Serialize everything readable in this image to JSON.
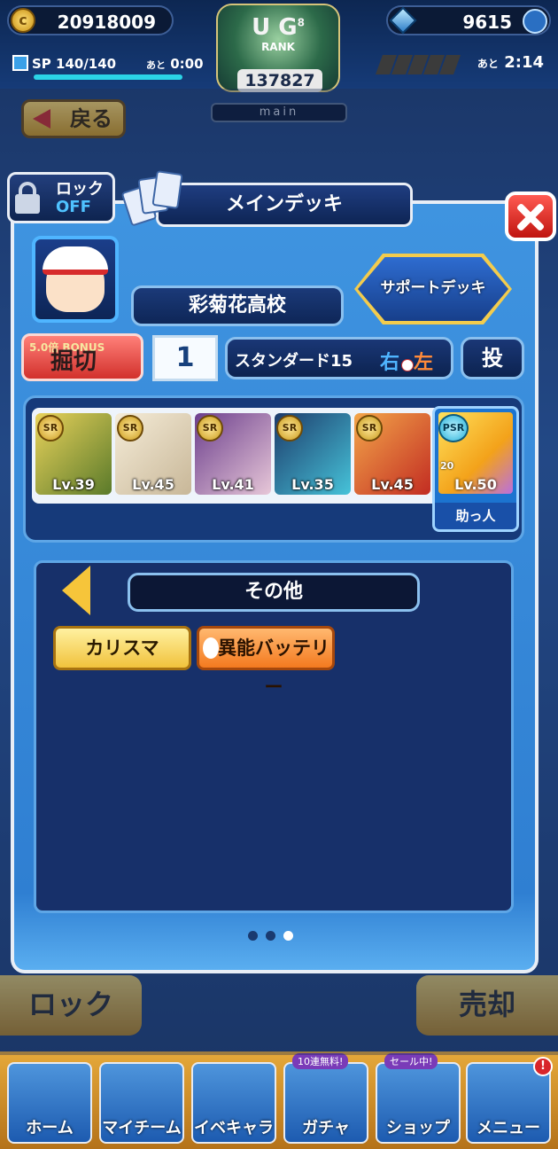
{
  "header": {
    "coins": "20918009",
    "coin_icon_glyph": "c",
    "gems": "9615",
    "sp_label": "SP 140/140",
    "sp_timer_prefix": "あと",
    "sp_timer": "0:00",
    "rank_ug": "U G",
    "rank_superscript": "8",
    "rank_label": "RANK",
    "rank_value": "137827",
    "mode_label": "main",
    "stamina_timer_prefix": "あと",
    "stamina_timer": "2:14",
    "back_label": "戻る"
  },
  "modal": {
    "lock_label": "ロック",
    "lock_state": "OFF",
    "title": "メインデッキ",
    "school": "彩菊花高校",
    "support_deck_label": "サポートデッキ",
    "bonus_small": "5.0倍 BONUS",
    "bonus_label": "掘切",
    "deck_number": "1",
    "deck_type": "スタンダード15",
    "hand_right": "右",
    "hand_left": "左",
    "position": "投",
    "cards": [
      {
        "rarity": "SR",
        "level": "Lv.39",
        "color_a": "#e9d25b",
        "color_b": "#5a7a2a"
      },
      {
        "rarity": "SR",
        "level": "Lv.45",
        "color_a": "#f5ecd8",
        "color_b": "#c8b798"
      },
      {
        "rarity": "SR",
        "level": "Lv.41",
        "color_a": "#6c3f8d",
        "color_b": "#e7c7d8"
      },
      {
        "rarity": "SR",
        "level": "Lv.35",
        "color_a": "#1d3b6b",
        "color_b": "#46c3d9"
      },
      {
        "rarity": "SR",
        "level": "Lv.45",
        "color_a": "#f3a64a",
        "color_b": "#c22c22"
      }
    ],
    "helper_card": {
      "rarity": "PSR",
      "level": "Lv.50",
      "helper_label": "助っ人",
      "mini_badge": "20"
    },
    "skill_category": "その他",
    "skills": [
      {
        "label": "カリスマ",
        "style": "gold"
      },
      {
        "label": "異能バッテリー",
        "style": "orange"
      }
    ],
    "page_indicator": {
      "total": 3,
      "active": 3
    }
  },
  "background_buttons": {
    "lock": "ロック",
    "sell": "売却"
  },
  "bottom_nav": [
    {
      "label": "ホーム",
      "tag": "",
      "badge": ""
    },
    {
      "label": "マイチーム",
      "tag": "",
      "badge": ""
    },
    {
      "label": "イベキャラ",
      "tag": "",
      "badge": ""
    },
    {
      "label": "ガチャ",
      "tag": "10連無料!",
      "badge": ""
    },
    {
      "label": "ショップ",
      "tag": "セール中!",
      "badge": ""
    },
    {
      "label": "メニュー",
      "tag": "",
      "badge": "!"
    }
  ]
}
